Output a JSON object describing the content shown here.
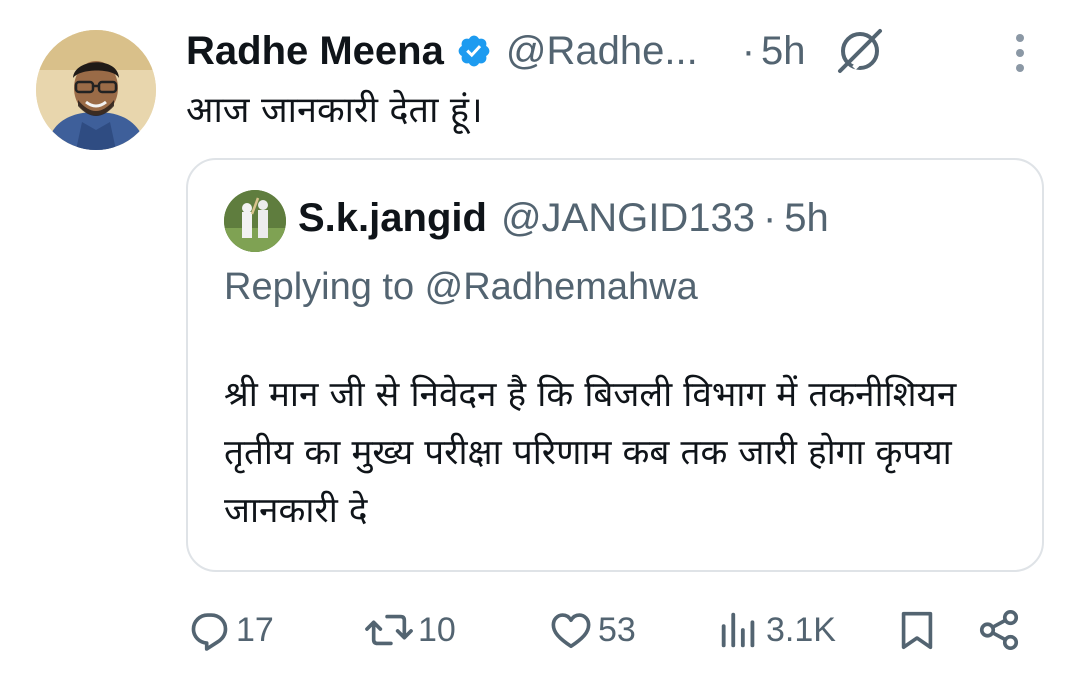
{
  "tweet": {
    "author_name": "Radhe Meena",
    "author_handle": "@Radhe...",
    "dot": "·",
    "time": "5h",
    "text": "आज जानकारी देता हूं।"
  },
  "quote": {
    "author_name": "S.k.jangid",
    "author_handle": "@JANGID133",
    "dot": "·",
    "time": "5h",
    "replying_to": "Replying to @Radhemahwa",
    "body": "श्री मान जी से निवेदन है कि बिजली विभाग में तकनीशियन तृतीय का मुख्य परीक्षा परिणाम कब तक जारी होगा कृपया जानकारी दे"
  },
  "actions": {
    "replies": "17",
    "retweets": "10",
    "likes": "53",
    "views": "3.1K"
  },
  "icons": [
    "verified-badge-icon",
    "grok-icon",
    "more-vertical-icon",
    "reply-icon",
    "retweet-icon",
    "like-icon",
    "views-icon",
    "bookmark-icon",
    "share-icon"
  ],
  "colors": {
    "text": "#0f1419",
    "secondary": "#536471",
    "verified": "#1d9bf0",
    "border": "#dfe3e7"
  }
}
